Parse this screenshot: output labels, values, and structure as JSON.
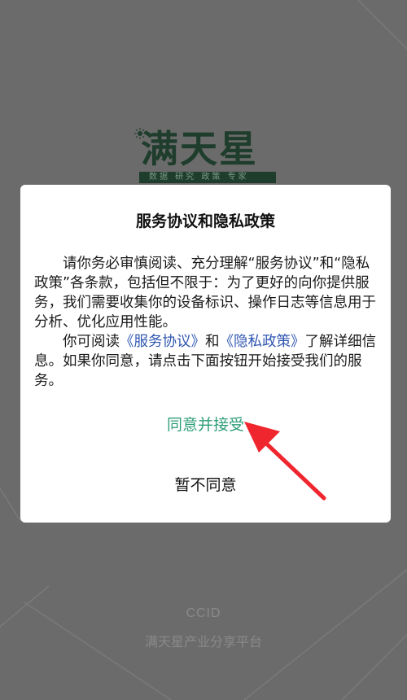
{
  "splash": {
    "logo_title": "满天星",
    "logo_tagline": "数据 研究 政策 专家",
    "footer_brand": "CCID",
    "footer_subtitle": "满天星产业分享平台"
  },
  "dialog": {
    "title": "服务协议和隐私政策",
    "para1": "请你务必审慎阅读、充分理解“服务协议”和“隐私政策”各条款，包括但不限于：为了更好的向你提供服务，我们需要收集你的设备标识、操作日志等信息用于分析、优化应用性能。",
    "para2_prefix": "你可阅读",
    "link_service": "《服务协议》",
    "para2_and": "和",
    "link_privacy": "《隐私政策》",
    "para2_suffix": "了解详细信息。如果你同意，请点击下面按钮开始接受我们的服务。",
    "agree_label": "同意并接受",
    "disagree_label": "暂不同意"
  },
  "colors": {
    "overlay": "#6b6b6b",
    "agree": "#2f9e7a",
    "link": "#2f56b0",
    "arrow": "#f0262e"
  },
  "icons": {
    "logo_sun": "sun-icon",
    "annotation_arrow": "red-arrow-icon"
  }
}
